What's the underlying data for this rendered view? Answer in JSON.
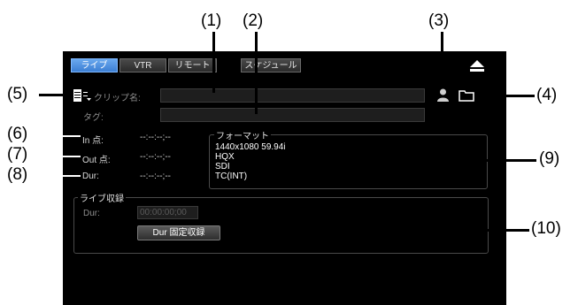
{
  "tabs": [
    {
      "label": "ライブ",
      "active": true
    },
    {
      "label": "VTR",
      "active": false
    },
    {
      "label": "リモート",
      "active": false
    }
  ],
  "schedule_button": "スケジュール",
  "eject_icon": "eject-icon",
  "clip_name": {
    "label": "クリップ名:",
    "value": ""
  },
  "tag": {
    "label": "タグ:",
    "value": ""
  },
  "timecodes": {
    "in_label": "In 点:",
    "in_value": "--:--:--;--",
    "out_label": "Out 点:",
    "out_value": "--:--:--;--",
    "dur_label": "Dur:",
    "dur_value": "--:--:--;--"
  },
  "format": {
    "title": "フォーマット",
    "lines": [
      "1440x1080 59.94i",
      "HQX",
      "SDI",
      "TC(INT)"
    ]
  },
  "live_rec": {
    "title": "ライブ収録",
    "dur_label": "Dur:",
    "dur_value": "00:00:00;00",
    "fixed_button": "Dur 固定収録"
  },
  "callouts": [
    "(1)",
    "(2)",
    "(3)",
    "(4)",
    "(5)",
    "(6)",
    "(7)",
    "(8)",
    "(9)",
    "(10)"
  ],
  "colors": {
    "accent": "#4a90e2",
    "panel": "#000000",
    "group_border": "#4a4a4a"
  }
}
